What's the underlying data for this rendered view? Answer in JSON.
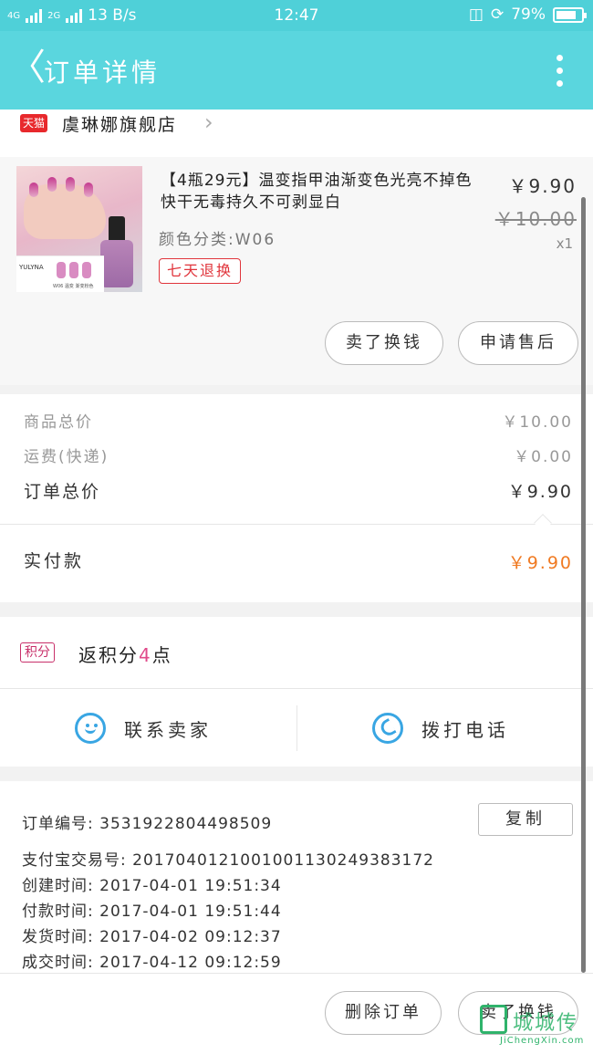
{
  "status_bar": {
    "network_left": "4G",
    "network_right": "2G",
    "speed": "13 B/s",
    "time": "12:47",
    "battery": "79%",
    "battery_level": 0.79
  },
  "header": {
    "title": "订单详情"
  },
  "shop": {
    "badge": "天猫",
    "name": "虞琳娜旗舰店"
  },
  "product": {
    "title": "【4瓶29元】温变指甲油渐变色光亮不掉色快干无毒持久不可剥显白",
    "spec": "颜色分类:W06",
    "tag": "七天退换",
    "price": "￥9.90",
    "original_price": "￥10.00",
    "quantity": "x1",
    "thumb_brand": "YULYNA",
    "thumb_caption": "W06 温变 渐变粉色",
    "buttons": {
      "sell": "卖了换钱",
      "after_sale": "申请售后"
    }
  },
  "summary": {
    "goods_total_label": "商品总价",
    "goods_total_value": "￥10.00",
    "shipping_label": "运费(快递)",
    "shipping_value": "￥0.00",
    "order_total_label": "订单总价",
    "order_total_value": "￥9.90",
    "paid_label": "实付款",
    "paid_value": "￥9.90"
  },
  "points": {
    "badge": "积分",
    "prefix": "返积分",
    "amount": "4",
    "suffix": "点"
  },
  "contact": {
    "seller": "联系卖家",
    "call": "拨打电话"
  },
  "order_info": {
    "order_no": "订单编号: 3531922804498509",
    "copy": "复制",
    "alipay_no": "支付宝交易号: 2017040121001001130249383172",
    "created": "创建时间: 2017-04-01 19:51:34",
    "paid": "付款时间: 2017-04-01 19:51:44",
    "shipped": "发货时间: 2017-04-02 09:12:37",
    "completed": "成交时间: 2017-04-12 09:12:59"
  },
  "footer": {
    "delete": "删除订单",
    "sell": "卖了换钱"
  },
  "watermark": {
    "text": "城城传",
    "url": "JiChengXin.com"
  },
  "colors": {
    "header": "#5ad6de",
    "accent_price": "#f07a22",
    "tag_red": "#e0343b",
    "icon_blue": "#39a6e3"
  }
}
